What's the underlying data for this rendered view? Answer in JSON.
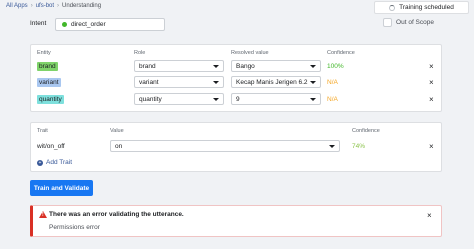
{
  "breadcrumb": {
    "apps": "All Apps",
    "app": "ufs-bot",
    "page": "Understanding"
  },
  "training_status": "Training scheduled",
  "intent": {
    "label": "Intent",
    "value": "direct_order"
  },
  "out_of_scope_label": "Out of Scope",
  "entities": {
    "headers": {
      "entity": "Entity",
      "role": "Role",
      "resolved": "Resolved value",
      "confidence": "Confidence"
    },
    "rows": [
      {
        "entity": "brand",
        "role": "brand",
        "resolved": "Bango",
        "confidence": "100%",
        "tag_color": "#7fd36a",
        "conf_color": "#42b72a"
      },
      {
        "entity": "variant",
        "role": "variant",
        "resolved": "Kecap Manis Jerigen 6.2KG",
        "confidence": "N/A",
        "tag_color": "#a9c7f0",
        "conf_color": "#f5a623"
      },
      {
        "entity": "quantity",
        "role": "quantity",
        "resolved": "9",
        "confidence": "N/A",
        "tag_color": "#7ee0dd",
        "conf_color": "#f5a623"
      }
    ]
  },
  "traits": {
    "headers": {
      "trait": "Trait",
      "value": "Value",
      "confidence": "Confidence"
    },
    "rows": [
      {
        "trait": "wit/on_off",
        "value": "on",
        "confidence": "74%",
        "conf_color": "#8bc34a"
      }
    ],
    "add_label": "Add Trait"
  },
  "train_button": "Train and Validate",
  "error": {
    "title": "There was an error validating the utterance.",
    "detail": "Permissions error"
  }
}
